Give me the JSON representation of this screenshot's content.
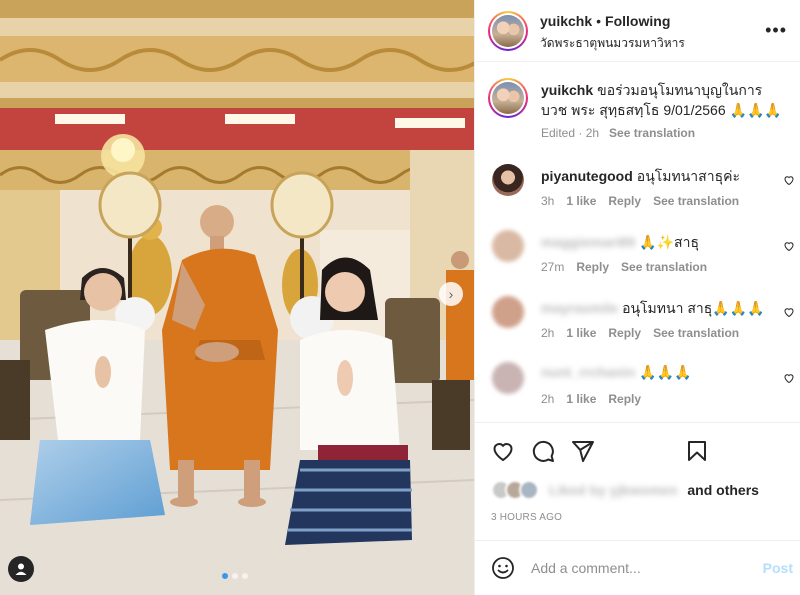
{
  "post": {
    "username": "yuikchk",
    "separator": "•",
    "follow_status": "Following",
    "location": "วัดพระธาตุพนมวรมหาวิหาร",
    "more_icon": "more-horizontal-icon"
  },
  "caption": {
    "username": "yuikchk",
    "text": "ขอร่วมอนุโมทนาบุญในการบวช พระ สุทฺธสทฺโธ 9/01/2566 🙏🙏🙏",
    "edited": "Edited · 2h",
    "see_translation": "See translation"
  },
  "comments": [
    {
      "username": "piyanutegood",
      "text": "อนุโมทนาสาธุค่ะ",
      "time": "3h",
      "likes": "1 like",
      "reply": "Reply",
      "see_translation": "See translation"
    },
    {
      "username": "maggiemari89",
      "text": "🙏✨สาธุ",
      "time": "27m",
      "likes": "",
      "reply": "Reply",
      "see_translation": "See translation"
    },
    {
      "username": "mayrasmile",
      "text": "อนุโมทนา สาธุ🙏🙏🙏",
      "time": "2h",
      "likes": "1 like",
      "reply": "Reply",
      "see_translation": "See translation"
    },
    {
      "username": "nunt_rrchanin",
      "text": "🙏🙏🙏",
      "time": "2h",
      "likes": "1 like",
      "reply": "Reply",
      "see_translation": ""
    }
  ],
  "actions": {
    "like_icon": "heart-icon",
    "comment_icon": "comment-icon",
    "share_icon": "send-icon",
    "save_icon": "bookmark-icon"
  },
  "likes": {
    "liked_by": "Liked by yjkwomen",
    "and_others": "and others"
  },
  "posted_time": "3 HOURS AGO",
  "add_comment": {
    "placeholder": "Add a comment...",
    "post_label": "Post",
    "emoji_icon": "emoji-icon"
  },
  "colors": {
    "accent": "#3797f0",
    "post_disabled": "#b2dffc",
    "monk_robe": "#d7761d",
    "ceiling_red": "#c3443e",
    "gold": "#d4a64a"
  }
}
